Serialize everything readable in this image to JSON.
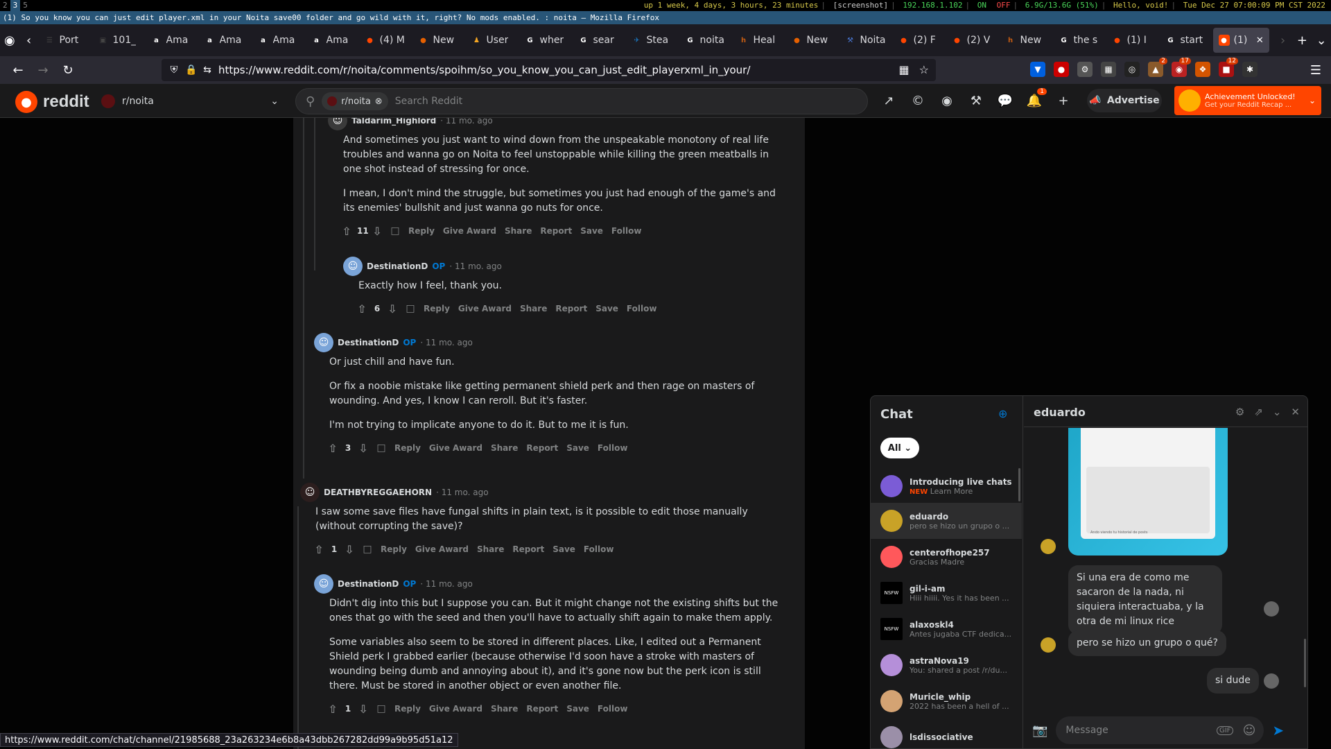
{
  "i3": {
    "workspaces": [
      "2",
      "3",
      "5"
    ],
    "status": {
      "uptime": "up 1 week, 4 days, 3 hours, 23 minutes",
      "mode": "[screenshot]",
      "ip": "192.168.1.102",
      "on": "ON",
      "off": "OFF",
      "mem": "6.9G/13.6G (51%)",
      "greet": "Hello, void!",
      "date": "Tue Dec 27 07:00:09 PM CST 2022"
    }
  },
  "window_title": "(1) So you know you can just edit player.xml in your Noita save00 folder and go wild with it, right? No mods enabled. : noita — Mozilla Firefox",
  "tabs": [
    {
      "title": "Port",
      "fav": "☰",
      "color": "#444"
    },
    {
      "title": "101_",
      "fav": "▣",
      "color": "#444"
    },
    {
      "title": "Ama",
      "fav": "a",
      "color": "#fff"
    },
    {
      "title": "Ama",
      "fav": "a",
      "color": "#fff"
    },
    {
      "title": "Ama",
      "fav": "a",
      "color": "#fff"
    },
    {
      "title": "Ama",
      "fav": "a",
      "color": "#fff"
    },
    {
      "title": "(4) M",
      "fav": "●",
      "color": "#ff4500"
    },
    {
      "title": "New",
      "fav": "●",
      "color": "#e66000"
    },
    {
      "title": "User",
      "fav": "♟",
      "color": "#f5a623"
    },
    {
      "title": "wher",
      "fav": "G",
      "color": "#fff"
    },
    {
      "title": "sear",
      "fav": "G",
      "color": "#fff"
    },
    {
      "title": "Stea",
      "fav": "✈",
      "color": "#1b75bc"
    },
    {
      "title": "noita",
      "fav": "G",
      "color": "#fff"
    },
    {
      "title": "Heal",
      "fav": "h",
      "color": "#c25b13"
    },
    {
      "title": "New",
      "fav": "●",
      "color": "#e66000"
    },
    {
      "title": "Noita",
      "fav": "⚒",
      "color": "#4a7ad9"
    },
    {
      "title": "(2) F",
      "fav": "●",
      "color": "#ff4500"
    },
    {
      "title": "(2) V",
      "fav": "●",
      "color": "#ff4500"
    },
    {
      "title": "New",
      "fav": "h",
      "color": "#c25b13"
    },
    {
      "title": "the s",
      "fav": "G",
      "color": "#fff"
    },
    {
      "title": "(1) I",
      "fav": "●",
      "color": "#ff4500"
    },
    {
      "title": "start",
      "fav": "G",
      "color": "#fff"
    }
  ],
  "active_tab": {
    "title": "(1)",
    "fav": "●",
    "color": "#ff4500"
  },
  "url": "https://www.reddit.com/r/noita/comments/spoihm/so_you_know_you_can_just_edit_playerxml_in_your/",
  "extensions": [
    {
      "icon": "▼",
      "color": "#0060df",
      "badge": ""
    },
    {
      "icon": "●",
      "color": "#c00",
      "badge": ""
    },
    {
      "icon": "⚙",
      "color": "#555",
      "badge": ""
    },
    {
      "icon": "▦",
      "color": "#444",
      "badge": ""
    },
    {
      "icon": "◎",
      "color": "#222",
      "badge": ""
    },
    {
      "icon": "▲",
      "color": "#8a5a2b",
      "badge": "2"
    },
    {
      "icon": "◉",
      "color": "#b22",
      "badge": "17"
    },
    {
      "icon": "❖",
      "color": "#d35400",
      "badge": ""
    },
    {
      "icon": "■",
      "color": "#a11",
      "badge": "12"
    },
    {
      "icon": "✱",
      "color": "#333",
      "badge": ""
    }
  ],
  "reddit": {
    "logo_text": "reddit",
    "subreddit": "r/noita",
    "search_chip": "r/noita",
    "search_placeholder": "Search Reddit",
    "notif_count": "1",
    "advertise": "Advertise",
    "achievement_title": "Achievement Unlocked!",
    "achievement_sub": "Get your Reddit Recap ..."
  },
  "actions": {
    "reply": "Reply",
    "award": "Give Award",
    "share": "Share",
    "report": "Report",
    "save": "Save",
    "follow": "Follow"
  },
  "comments": [
    {
      "author": "Taldarim_Highlord",
      "op": "",
      "time": "11 mo. ago",
      "votes": "11",
      "paragraphs": [
        "And sometimes you just want to wind down from the unspeakable monotony of real life troubles and wanna go on Noita to feel unstoppable while killing the green meatballs in one shot instead of stressing for once.",
        "I mean, I don't mind the struggle, but sometimes you just had enough of the game's and its enemies' bullshit and just wanna go nuts for once."
      ]
    },
    {
      "author": "DestinationD",
      "op": "OP",
      "time": "11 mo. ago",
      "votes": "6",
      "paragraphs": [
        "Exactly how I feel, thank you."
      ]
    },
    {
      "author": "DestinationD",
      "op": "OP",
      "time": "11 mo. ago",
      "votes": "3",
      "paragraphs": [
        "Or just chill and have fun.",
        "Or fix a noobie mistake like getting permanent shield perk and then rage on masters of wounding. And yes, I know I can reroll. But it's faster.",
        "I'm not trying to implicate anyone to do it. But to me it is fun."
      ]
    },
    {
      "author": "DEATHBYREGGAEHORN",
      "op": "",
      "time": "11 mo. ago",
      "votes": "1",
      "paragraphs": [
        "I saw some save files have fungal shifts in plain text, is it possible to edit those manually (without corrupting the save)?"
      ]
    },
    {
      "author": "DestinationD",
      "op": "OP",
      "time": "11 mo. ago",
      "votes": "1",
      "paragraphs": [
        "Didn't dig into this but I suppose you can. But it might change not the existing shifts but the ones that go with the seed and then you'll have to actually shift again to make them apply.",
        "Some variables also seem to be stored in different places. Like, I edited out a Permanent Shield perk I grabbed earlier (because otherwise I'd soon have a stroke with masters of wounding being dumb and annoying about it), and it's gone now but the perk icon is still there. Must be stored in another object or even another file."
      ]
    }
  ],
  "hover_url": "https://www.reddit.com/chat/channel/21985688_23a263234e6b8a43dbb267282dd99a9b95d51a12",
  "chat": {
    "title": "Chat",
    "filter": "All",
    "items": [
      {
        "name": "Introducing live chats",
        "tag": "NEW",
        "preview": "Learn More",
        "color": "#7b5cd6"
      },
      {
        "name": "eduardo",
        "tag": "",
        "preview": "pero se hizo un grupo o ...",
        "color": "#c9a227"
      },
      {
        "name": "centerofhope257",
        "tag": "",
        "preview": "Gracias Madre",
        "color": "#ff585b"
      },
      {
        "name": "gil-i-am",
        "tag": "",
        "preview": "Hiii hiiii. Yes it has been ...",
        "color": "#000"
      },
      {
        "name": "alaxoskl4",
        "tag": "",
        "preview": "Antes jugaba CTF dedica...",
        "color": "#000"
      },
      {
        "name": "astraNova19",
        "tag": "",
        "preview": "You: shared a post /r/du...",
        "color": "#b58fd9"
      },
      {
        "name": "Muricle_whip",
        "tag": "",
        "preview": "2022 has been a hell of ...",
        "color": "#d4a373"
      },
      {
        "name": "lsdissociative",
        "tag": "",
        "preview": "",
        "color": "#9b8fa8"
      }
    ],
    "nsfw_label": "NSFW",
    "convo_name": "eduardo",
    "image_caption": "Ando viendo tu historial de posts",
    "messages": [
      {
        "text": "Si una era de como me sacaron de la nada, ni siquiera interactuaba, y la otra de mi linux rice",
        "side": "right"
      },
      {
        "text": "pero se hizo un grupo o qué?",
        "side": "left"
      },
      {
        "text": "si dude",
        "side": "right"
      }
    ],
    "message_placeholder": "Message",
    "gif_label": "GIF"
  }
}
